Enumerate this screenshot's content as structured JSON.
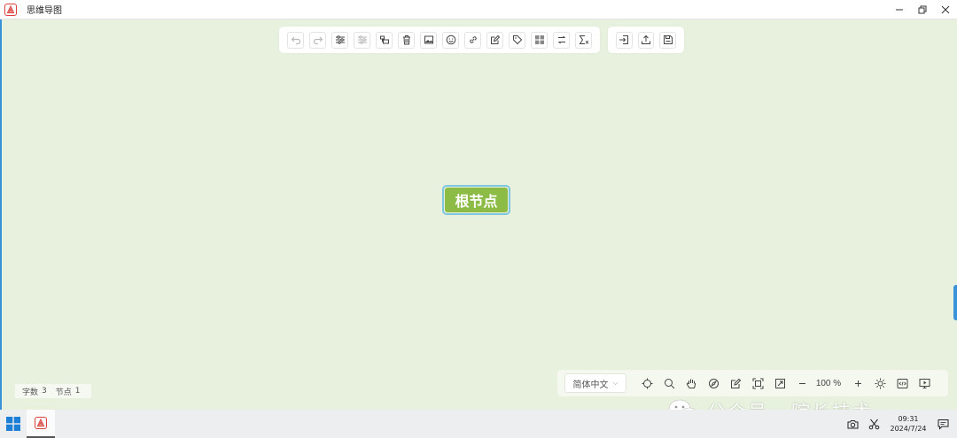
{
  "window": {
    "title": "思维导图"
  },
  "toolbar_main": [
    {
      "name": "undo-button",
      "icon": "undo-icon",
      "disabled": true
    },
    {
      "name": "redo-button",
      "icon": "redo-icon",
      "disabled": true
    },
    {
      "name": "style-button",
      "icon": "sliders-icon",
      "disabled": false
    },
    {
      "name": "clear-style-button",
      "icon": "sliders-clear-icon",
      "disabled": true
    },
    {
      "name": "insert-node-button",
      "icon": "node-icon",
      "disabled": false
    },
    {
      "name": "delete-button",
      "icon": "trash-icon",
      "disabled": false
    },
    {
      "name": "image-button",
      "icon": "image-icon",
      "disabled": false
    },
    {
      "name": "emoji-button",
      "icon": "smile-icon",
      "disabled": false
    },
    {
      "name": "link-button",
      "icon": "link-icon",
      "disabled": false
    },
    {
      "name": "note-button",
      "icon": "edit-icon",
      "disabled": false
    },
    {
      "name": "tag-button",
      "icon": "tag-icon",
      "disabled": false
    },
    {
      "name": "summary-button",
      "icon": "grid-icon",
      "disabled": false
    },
    {
      "name": "relation-button",
      "icon": "relation-icon",
      "disabled": false
    },
    {
      "name": "formula-button",
      "icon": "sigma-icon",
      "disabled": false
    }
  ],
  "toolbar_file": [
    {
      "name": "import-button",
      "icon": "import-icon"
    },
    {
      "name": "export-button",
      "icon": "upload-icon"
    },
    {
      "name": "save-button",
      "icon": "save-icon"
    }
  ],
  "root_node": {
    "label": "根节点"
  },
  "stats": {
    "word_count_label": "字数",
    "word_count": "3",
    "node_count_label": "节点",
    "node_count": "1"
  },
  "bottombar": {
    "language": "简体中文",
    "zoom": "100",
    "zoom_unit": "%"
  },
  "watermark": {
    "text": "公众号 · 院长技术"
  },
  "taskbar": {
    "time": "09:31",
    "date": "2024/7/24"
  },
  "colors": {
    "canvas": "#e7f1de",
    "root_fill": "#8cbc45",
    "root_border": "#7ec6df",
    "accent": "#3a92d8"
  }
}
